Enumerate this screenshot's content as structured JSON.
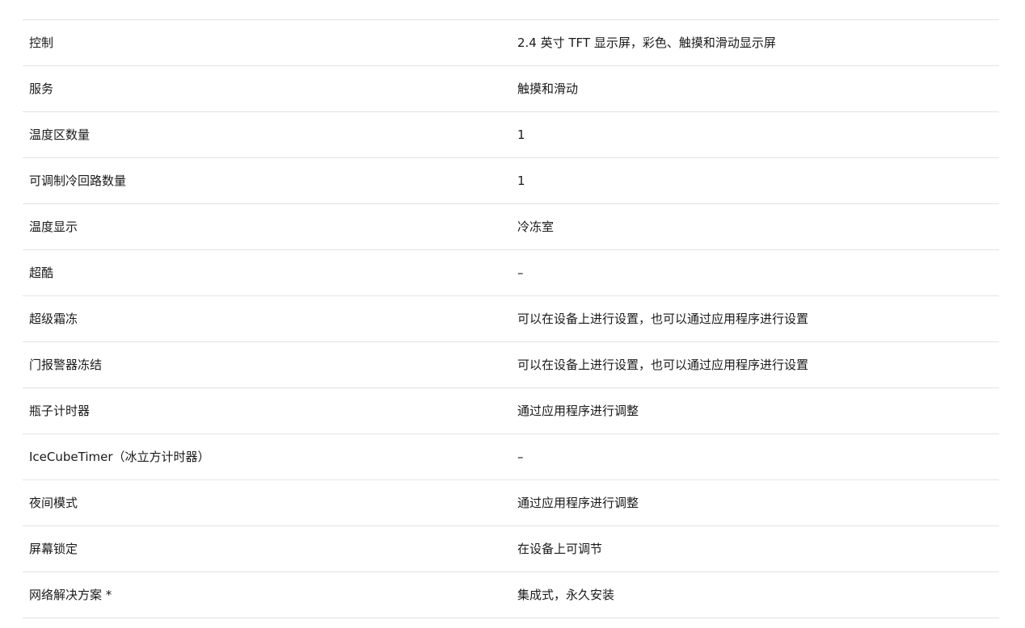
{
  "specs": [
    {
      "label": "控制",
      "value": "2.4 英寸 TFT 显示屏，彩色、触摸和滑动显示屏"
    },
    {
      "label": "服务",
      "value": "触摸和滑动"
    },
    {
      "label": "温度区数量",
      "value": "1"
    },
    {
      "label": "可调制冷回路数量",
      "value": "1"
    },
    {
      "label": "温度显示",
      "value": "冷冻室"
    },
    {
      "label": "超酷",
      "value": "–"
    },
    {
      "label": "超级霜冻",
      "value": "可以在设备上进行设置，也可以通过应用程序进行设置"
    },
    {
      "label": "门报警器冻结",
      "value": "可以在设备上进行设置，也可以通过应用程序进行设置"
    },
    {
      "label": "瓶子计时器",
      "value": "通过应用程序进行调整"
    },
    {
      "label": "IceCubeTimer（冰立方计时器）",
      "value": "–"
    },
    {
      "label": "夜间模式",
      "value": "通过应用程序进行调整"
    },
    {
      "label": "屏幕锁定",
      "value": "在设备上可调节"
    },
    {
      "label": "网络解决方案 *",
      "value": "集成式，永久安装"
    }
  ]
}
